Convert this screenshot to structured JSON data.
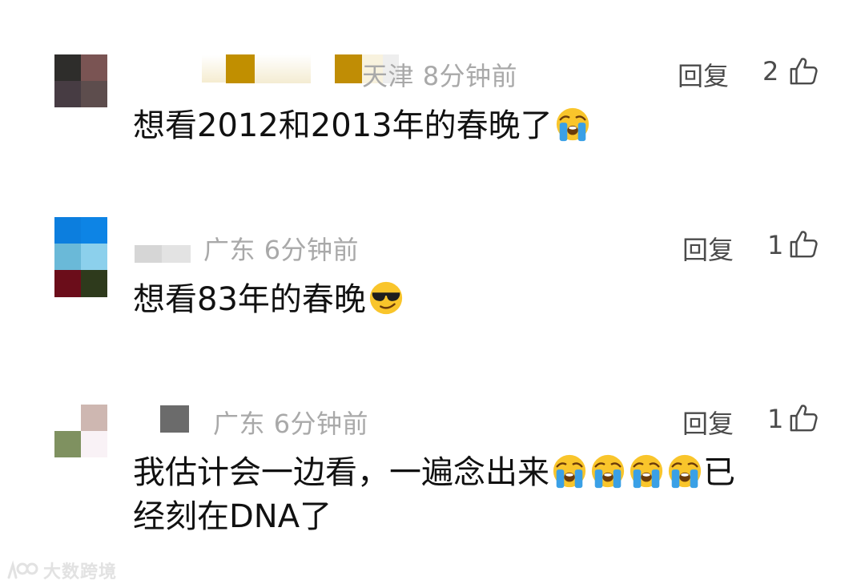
{
  "comments": [
    {
      "location": "天津",
      "time": "8分钟前",
      "reply_label": "回复",
      "likes": "2",
      "content_text": "想看2012和2013年的春晚了",
      "content_emojis": [
        "loudly-crying-face"
      ]
    },
    {
      "location": "广东",
      "time": "6分钟前",
      "reply_label": "回复",
      "likes": "1",
      "content_text": "想看83年的春晚",
      "content_emojis": [
        "smiling-face-with-sunglasses"
      ]
    },
    {
      "location": "广东",
      "time": "6分钟前",
      "reply_label": "回复",
      "likes": "1",
      "content_line1": "我估计会一边看，一遍念出来",
      "content_emojis": [
        "loudly-crying-face",
        "loudly-crying-face",
        "loudly-crying-face",
        "loudly-crying-face"
      ],
      "content_line1_tail": "已",
      "content_line2": "经刻在DNA了"
    }
  ],
  "watermark": {
    "text": "大数跨境",
    "icon": "brand-logo-icon"
  },
  "colors": {
    "meta_gray": "#a9a9a9",
    "action_gray": "#4b4b4b",
    "text": "#111111"
  }
}
